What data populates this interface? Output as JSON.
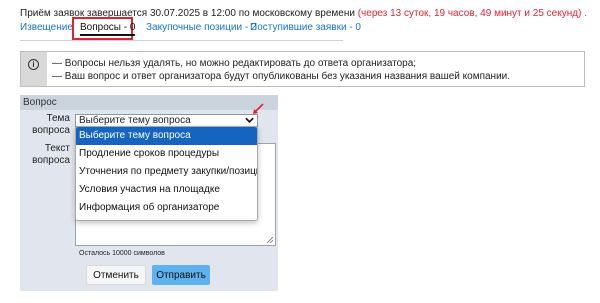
{
  "deadline": {
    "text": "Приём заявок завершается 30.07.2025 в 12:00 по московскому времени",
    "remaining": "(через 13 суток, 19 часов, 49 минут и 25 секунд) ."
  },
  "tabs": [
    {
      "label": "Извещение",
      "active": false
    },
    {
      "label": "Вопросы - 0",
      "active": true
    },
    {
      "label": "Закупочные позиции - 2",
      "active": false
    },
    {
      "label": "Поступившие заявки - 0",
      "active": false
    }
  ],
  "notice": {
    "icon": "info-icon",
    "lines": [
      "— Вопросы нельзя удалять, но можно редактировать до ответа организатора;",
      "— Ваш вопрос и ответ организатора будут опубликованы без указания названия вашей компании."
    ]
  },
  "form": {
    "header": "Вопрос",
    "topic_label_1": "Тема",
    "topic_label_2": "вопроса",
    "text_label_1": "Текст",
    "text_label_2": "вопроса",
    "topic_select_value": "Выберите тему вопроса",
    "char_counter": "Осталось 10000 символов",
    "cancel_label": "Отменить",
    "send_label": "Отправить"
  },
  "dropdown": {
    "options": [
      {
        "label": "Выберите тему вопроса",
        "selected": true
      },
      {
        "label": "Продление сроков процедуры",
        "selected": false
      },
      {
        "label": "Уточнения по предмету закупки/позициям",
        "selected": false
      },
      {
        "label": "Условия участия на площадке",
        "selected": false
      },
      {
        "label": "Информация об организаторе",
        "selected": false
      }
    ]
  },
  "colors": {
    "accent_link": "#1a73c8",
    "remaining_time": "#e8232f",
    "highlight_border": "#e0232e",
    "selected_option": "#1565c0",
    "send_button": "#5eb2ee"
  }
}
